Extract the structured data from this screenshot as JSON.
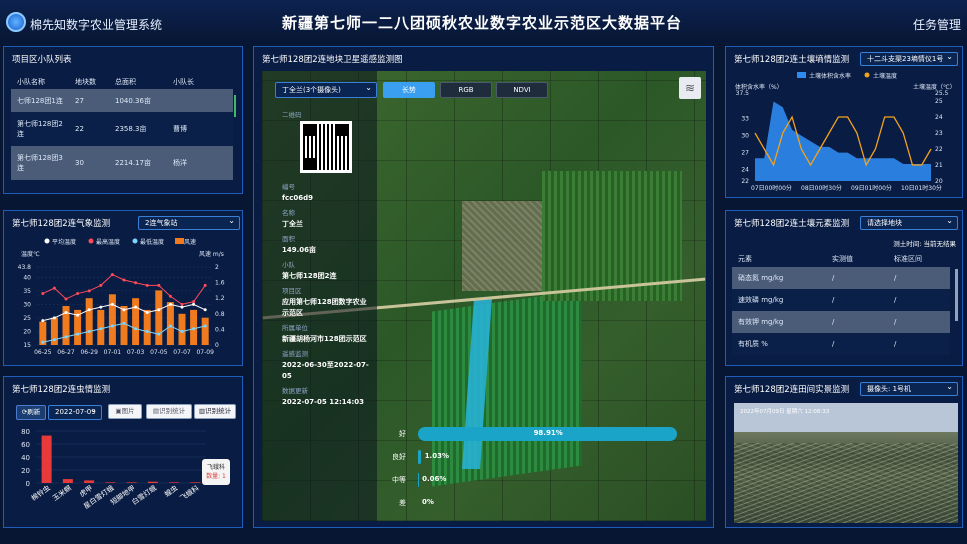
{
  "header": {
    "system_name": "棉先知数字农业管理系统",
    "title": "新疆第七师一二八团硕秋农业数字农业示范区大数据平台",
    "task_manager": "任务管理"
  },
  "team_list": {
    "title": "项目区小队列表",
    "headers": [
      "小队名称",
      "地块数",
      "总面积",
      "小队长"
    ],
    "rows": [
      [
        "七师128团1连",
        "27",
        "1040.36亩",
        ""
      ],
      [
        "第七师128团2连",
        "22",
        "2358.3亩",
        "曹博"
      ],
      [
        "第七师128团3连",
        "30",
        "2214.17亩",
        "杨洋"
      ]
    ]
  },
  "weather": {
    "title": "第七师128团2连气象监测",
    "station": "2连气象站",
    "legend": [
      "平均温度",
      "最高温度",
      "最低温度",
      "风速"
    ],
    "left_unit": "温度℃",
    "right_unit": "风速 m/s"
  },
  "chart_data": [
    {
      "type": "line",
      "title": "第七师128团2连气象监测",
      "categories": [
        "06-25",
        "06-26",
        "06-27",
        "06-28",
        "06-29",
        "06-30",
        "07-01",
        "07-02",
        "07-03",
        "07-04",
        "07-05",
        "07-06",
        "07-07",
        "07-08",
        "07-09"
      ],
      "series": [
        {
          "name": "平均温度",
          "values": [
            24,
            25,
            27,
            26,
            28,
            29,
            30,
            28,
            29,
            27,
            28,
            30,
            29,
            30,
            28
          ]
        },
        {
          "name": "最高温度",
          "values": [
            34,
            36,
            32,
            34,
            35,
            37,
            41,
            39,
            38,
            37,
            37,
            33,
            30,
            31,
            37
          ]
        },
        {
          "name": "最低温度",
          "values": [
            16,
            17,
            18,
            19,
            20,
            21,
            22,
            23,
            21,
            20,
            19,
            22,
            20,
            21,
            22
          ]
        },
        {
          "name": "风速",
          "values": [
            0.6,
            0.7,
            1.0,
            0.9,
            1.2,
            0.9,
            1.3,
            1.0,
            1.2,
            0.9,
            1.4,
            1.1,
            0.8,
            0.9,
            0.7
          ]
        }
      ],
      "ylim": [
        15,
        43.8
      ],
      "y2lim": [
        0,
        2
      ],
      "yticks": [
        15,
        20,
        25,
        30,
        35,
        40,
        43.8
      ],
      "y2ticks": [
        0,
        0.4,
        0.8,
        1.2,
        1.6,
        2
      ]
    },
    {
      "type": "bar",
      "title": "第七师128团2连虫情监测",
      "categories": [
        "棉铃虫",
        "玉米螟",
        "虎甲",
        "星白雪灯蛾",
        "短脚地甲",
        "白雪灯蛾",
        "蝗虫",
        "飞蛾科"
      ],
      "values": [
        73,
        6,
        4,
        1,
        1,
        2,
        1,
        1
      ],
      "ylim": [
        0,
        80
      ],
      "yticks": [
        0,
        20,
        40,
        60,
        80
      ]
    },
    {
      "type": "line",
      "title": "第七师128团2连土壤墒情监测",
      "x_ticks": [
        "07日00时00分",
        "08日00时30分",
        "09日01时00分",
        "10日01时30分"
      ],
      "series": [
        {
          "name": "土壤体积含水率",
          "values": [
            26,
            26,
            36,
            35,
            31,
            30,
            29,
            28,
            28,
            27,
            27,
            26,
            26,
            26,
            26,
            26,
            25,
            25,
            25,
            25
          ]
        },
        {
          "name": "土壤温度",
          "values": [
            23,
            22,
            21,
            23,
            24,
            22,
            21,
            22,
            23,
            24,
            24,
            23,
            21,
            22,
            24,
            24,
            23,
            21,
            21,
            22
          ]
        }
      ],
      "ylim": [
        22,
        37.5
      ],
      "yticks": [
        22,
        24,
        27,
        30,
        33,
        37.5
      ],
      "y2lim": [
        20,
        25.5
      ],
      "y2ticks": [
        20,
        21,
        22,
        23,
        24,
        25,
        25.5
      ]
    }
  ],
  "pest": {
    "title": "第七师128团2连虫情监测",
    "refresh": "刷新",
    "date": "2022-07-09",
    "btn_images": "图片",
    "btn_identify_stats": "识别统计",
    "btn_recog_stats": "识别统计",
    "tooltip_name": "飞蛾科",
    "tooltip_count": "数量: 1"
  },
  "map": {
    "title": "第七师128团2连地块卫星遥感监测图",
    "plot_select": "丁全兰(3个摄像头)",
    "tabs": [
      "长势",
      "RGB",
      "NDVI"
    ],
    "active_tab": "长势",
    "qr_label": "二维码",
    "fields": [
      {
        "label": "编号",
        "value": "fcc06d9"
      },
      {
        "label": "名称",
        "value": "丁全兰"
      },
      {
        "label": "面积",
        "value": "149.06亩"
      },
      {
        "label": "小队",
        "value": "第七师128团2连"
      },
      {
        "label": "项目区",
        "value": "应用第七师128团数字农业示范区"
      },
      {
        "label": "所属单位",
        "value": "新疆胡杨河市128团示范区"
      },
      {
        "label": "遥感监测",
        "value": "2022-06-30至2022-07-05"
      },
      {
        "label": "数据更新",
        "value": "2022-07-05 12:14:03"
      }
    ],
    "growth": [
      {
        "label": "好",
        "value": "98.91%",
        "pct": 98.91
      },
      {
        "label": "良好",
        "value": "1.03%",
        "pct": 1.03
      },
      {
        "label": "中等",
        "value": "0.06%",
        "pct": 0.06
      },
      {
        "label": "差",
        "value": "0%",
        "pct": 0
      }
    ]
  },
  "soil_moisture": {
    "title": "第七师128团2连土壤墒情监测",
    "device": "十二斗支渠23墒情仪1号",
    "legend": [
      "土壤体积含水率",
      "土壤温度"
    ],
    "left_unit": "体积含水率（%）",
    "right_unit": "土壤温度（℃）"
  },
  "soil_elements": {
    "title": "第七师128团2连土壤元素监测",
    "select_placeholder": "请选择地块",
    "note": "测土时间: 当前无结果",
    "headers": [
      "元素",
      "实测值",
      "标准区间"
    ],
    "rows": [
      [
        "硝态氮 mg/kg",
        "/",
        "/"
      ],
      [
        "速效磷 mg/kg",
        "/",
        "/"
      ],
      [
        "有效钾 mg/kg",
        "/",
        "/"
      ],
      [
        "有机质 %",
        "/",
        "/"
      ]
    ]
  },
  "camera": {
    "title": "第七师128团2连田间实景监测",
    "camera": "摄像头: 1号机",
    "overlay": "2022年07月09日 星期六 12:08:33"
  },
  "colors": {
    "accent": "#1e5db8",
    "bar_orange": "#f07a1e",
    "moisture_blue": "#2f8bf0",
    "growth_bar": "#1aa4c8"
  }
}
